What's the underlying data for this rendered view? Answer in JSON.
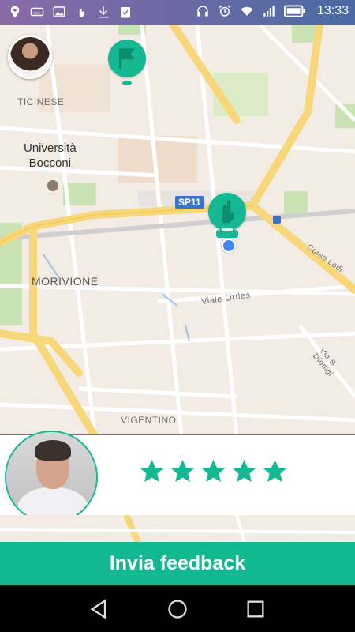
{
  "status_bar": {
    "time": "13:33",
    "left_icons": [
      "location-pin-icon",
      "keyboard-icon",
      "image-icon",
      "hand-icon",
      "download-icon",
      "clipboard-check-icon"
    ],
    "right_icons": [
      "headphones-icon",
      "alarm-icon",
      "wifi-icon",
      "signal-icon",
      "battery-icon"
    ]
  },
  "map": {
    "labels": {
      "ticinese": "TICINESE",
      "universita": "Università",
      "bocconi": "Bocconi",
      "morivione": "MORIVIONE",
      "vigentino": "VIGENTINO",
      "viale_ortles": "Viale Ortles",
      "corso_lodi": "Corso Lodi",
      "via_s_dionigi": "Via S. Dionigi",
      "route_shield": "SP11"
    },
    "colors": {
      "pin": "#15b892",
      "location": "#4285f4",
      "major_road": "#f7d77a"
    }
  },
  "rating": {
    "stars": 5,
    "max_stars": 5,
    "star_color": "#15b892"
  },
  "cta": {
    "label": "Invia feedback",
    "color": "#14b890"
  },
  "nav": {
    "icons": [
      "back-icon",
      "home-icon",
      "recents-icon"
    ]
  }
}
